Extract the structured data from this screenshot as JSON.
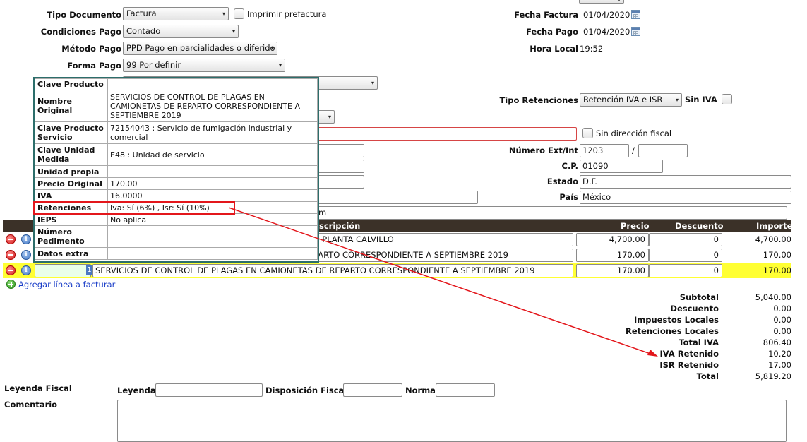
{
  "header": {
    "tipo_documento_label": "Tipo Documento",
    "tipo_documento_value": "Factura",
    "imprimir_prefactura_label": "Imprimir prefactura",
    "condiciones_pago_label": "Condiciones Pago",
    "condiciones_pago_value": "Contado",
    "metodo_pago_label": "Método Pago",
    "metodo_pago_value": "PPD Pago en parcialidades o diferido",
    "forma_pago_label": "Forma Pago",
    "forma_pago_value": "99 Por definir",
    "fecha_factura_label": "Fecha Factura",
    "fecha_factura_value": "01/04/2020",
    "fecha_pago_label": "Fecha Pago",
    "fecha_pago_value": "01/04/2020",
    "hora_local_label": "Hora Local",
    "hora_local_value": "19:52"
  },
  "retenciones": {
    "tipo_label": "Tipo Retenciones",
    "tipo_value": "Retención IVA e ISR",
    "sin_iva_label": "Sin IVA"
  },
  "address": {
    "partial_name": "/.",
    "sin_direccion_label": "Sin dirección fiscal",
    "numero_label": "Número Ext/Int",
    "numero_ext": "1203",
    "numero_sep": "/",
    "numero_int": "",
    "cp_label": "C.P.",
    "cp_value": "01090",
    "estado_label": "Estado",
    "estado_value": "D.F.",
    "pais_label": "País",
    "pais_value": "México",
    "email_partial": "om"
  },
  "table": {
    "col_descripcion": "scripción",
    "col_precio": "Precio",
    "col_descuento": "Descuento",
    "col_importe": "Importe",
    "rows": [
      {
        "descripcion": "N PLANTA CALVILLO",
        "precio": "4,700.00",
        "descuento": "0",
        "importe": "4,700.00"
      },
      {
        "descripcion": "PARTO CORRESPONDIENTE A SEPTIEMBRE 2019",
        "precio": "170.00",
        "descuento": "0",
        "importe": "170.00"
      },
      {
        "descripcion": "SERVICIOS DE CONTROL DE PLAGAS EN CAMIONETAS DE REPARTO CORRESPONDIENTE A SEPTIEMBRE 2019",
        "precio": "170.00",
        "descuento": "0",
        "importe": "170.00",
        "code_marker": "1"
      }
    ],
    "add_line_label": "Agregar línea a facturar"
  },
  "totals": {
    "subtotal_label": "Subtotal",
    "subtotal": "5,040.00",
    "descuento_label": "Descuento",
    "descuento": "0.00",
    "impuestos_locales_label": "Impuestos Locales",
    "impuestos_locales": "0.00",
    "retenciones_locales_label": "Retenciones Locales",
    "retenciones_locales": "0.00",
    "total_iva_label": "Total IVA",
    "total_iva": "806.40",
    "iva_retenido_label": "IVA Retenido",
    "iva_retenido": "10.20",
    "isr_retenido_label": "ISR Retenido",
    "isr_retenido": "17.00",
    "total_label": "Total",
    "total": "5,819.20"
  },
  "footer": {
    "leyenda_fiscal_label": "Leyenda Fiscal",
    "leyenda_label": "Leyenda",
    "disposicion_label": "Disposición Fiscal",
    "norma_label": "Norma",
    "comentario_label": "Comentario"
  },
  "popup": {
    "rows": [
      {
        "k": "Clave Producto",
        "v": ""
      },
      {
        "k": "Nombre Original",
        "v": "SERVICIOS DE CONTROL DE PLAGAS EN CAMIONETAS DE REPARTO CORRESPONDIENTE A SEPTIEMBRE 2019"
      },
      {
        "k": "Clave Producto Servicio",
        "v": "72154043 : Servicio de fumigación industrial y comercial"
      },
      {
        "k": "Clave Unidad Medida",
        "v": "E48 : Unidad de servicio"
      },
      {
        "k": "Unidad propia",
        "v": ""
      },
      {
        "k": "Precio Original",
        "v": "170.00"
      },
      {
        "k": "IVA",
        "v": "16.0000"
      },
      {
        "k": "Retenciones",
        "v": "Iva: Sí (6%) , Isr: Sí (10%)"
      },
      {
        "k": "IEPS",
        "v": "No aplica"
      },
      {
        "k": "Número Pedimento",
        "v": ""
      },
      {
        "k": "Datos extra",
        "v": ""
      }
    ]
  },
  "colors": {
    "header_bg": "#3b3128",
    "highlight_row": "#ffff33",
    "annotation_red": "#e3161b",
    "popup_border": "#2c6e6b",
    "link_blue": "#1a3ec8"
  }
}
